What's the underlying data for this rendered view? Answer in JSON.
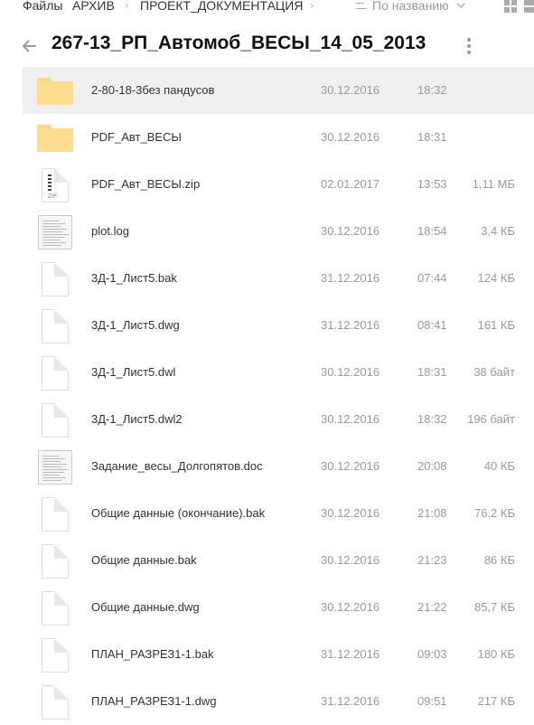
{
  "breadcrumbs": [
    {
      "label": "Файлы"
    },
    {
      "label": "АРХИВ"
    },
    {
      "label": "ПРОЕКТ_ДОКУМЕНТАЦИЯ"
    }
  ],
  "sort": {
    "label": "По названию",
    "icon": "chevron-down-icon"
  },
  "folder_title": "267-13_РП_Автомоб_ВЕСЫ_14_05_2013",
  "colors": {
    "folder": "#fcdc8f",
    "selected_row": "#f0f0f0",
    "muted_text": "#999999"
  },
  "files": [
    {
      "name": "2-80-18-3без пандусов",
      "date": "30.12.2016",
      "time": "18:32",
      "size": "",
      "type": "folder",
      "selected": true
    },
    {
      "name": "PDF_Авт_ВЕСЫ",
      "date": "30.12.2016",
      "time": "18:31",
      "size": "",
      "type": "folder"
    },
    {
      "name": "PDF_Авт_ВЕСЫ.zip",
      "date": "02.01.2017",
      "time": "13:53",
      "size": "1,11 МБ",
      "type": "zip"
    },
    {
      "name": "plot.log",
      "date": "30.12.2016",
      "time": "18:54",
      "size": "3,4 КБ",
      "type": "thumb"
    },
    {
      "name": "3Д-1_Лист5.bak",
      "date": "31.12.2016",
      "time": "07:44",
      "size": "124 КБ",
      "type": "file"
    },
    {
      "name": "3Д-1_Лист5.dwg",
      "date": "31.12.2016",
      "time": "08:41",
      "size": "161 КБ",
      "type": "file"
    },
    {
      "name": "3Д-1_Лист5.dwl",
      "date": "30.12.2016",
      "time": "18:31",
      "size": "38 байт",
      "type": "file"
    },
    {
      "name": "3Д-1_Лист5.dwl2",
      "date": "30.12.2016",
      "time": "18:32",
      "size": "196 байт",
      "type": "file"
    },
    {
      "name": "Задание_весы_Долгопятов.doc",
      "date": "30.12.2016",
      "time": "20:08",
      "size": "40 КБ",
      "type": "thumb"
    },
    {
      "name": "Общие данные (окончание).bak",
      "date": "30.12.2016",
      "time": "21:08",
      "size": "76,2 КБ",
      "type": "file"
    },
    {
      "name": "Общие данные.bak",
      "date": "30.12.2016",
      "time": "21:23",
      "size": "86 КБ",
      "type": "file"
    },
    {
      "name": "Общие данные.dwg",
      "date": "30.12.2016",
      "time": "21:22",
      "size": "85,7 КБ",
      "type": "file"
    },
    {
      "name": "ПЛАН_РАЗРЕЗ1-1.bak",
      "date": "31.12.2016",
      "time": "09:03",
      "size": "180 КБ",
      "type": "file"
    },
    {
      "name": "ПЛАН_РАЗРЕЗ1-1.dwg",
      "date": "31.12.2016",
      "time": "09:51",
      "size": "217 КБ",
      "type": "file"
    }
  ]
}
